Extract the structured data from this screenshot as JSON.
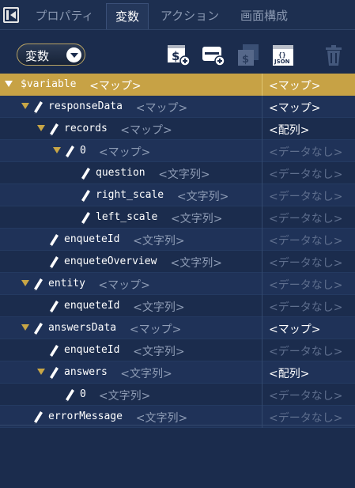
{
  "tabs": [
    {
      "label": "プロパティ",
      "active": false
    },
    {
      "label": "変数",
      "active": true
    },
    {
      "label": "アクション",
      "active": false
    },
    {
      "label": "画面構成",
      "active": false
    }
  ],
  "scope_select": {
    "value": "変数"
  },
  "toolbar_icons": {
    "add_variable": "dollar-add-icon",
    "add_storage": "storage-add-icon",
    "convert": "dollar-stack-icon",
    "json": "JSON",
    "delete": "trash-icon"
  },
  "tree": [
    {
      "name": "$variable",
      "type": "<マップ>",
      "value": "<マップ>",
      "expanded": true,
      "level": 0
    },
    {
      "name": "responseData",
      "type": "<マップ>",
      "value": "<マップ>",
      "expanded": true,
      "level": 1
    },
    {
      "name": "records",
      "type": "<マップ>",
      "value": "<配列>",
      "expanded": true,
      "level": 2
    },
    {
      "name": "0",
      "type": "<マップ>",
      "value": "<データなし>",
      "expanded": true,
      "level": 3
    },
    {
      "name": "question",
      "type": "<文字列>",
      "value": "<データなし>",
      "level": 4
    },
    {
      "name": "right_scale",
      "type": "<文字列>",
      "value": "<データなし>",
      "level": 4
    },
    {
      "name": "left_scale",
      "type": "<文字列>",
      "value": "<データなし>",
      "level": 4
    },
    {
      "name": "enqueteId",
      "type": "<文字列>",
      "value": "<データなし>",
      "level": 2
    },
    {
      "name": "enqueteOverview",
      "type": "<文字列>",
      "value": "<データなし>",
      "level": 2
    },
    {
      "name": "entity",
      "type": "<マップ>",
      "value": "<データなし>",
      "expanded": true,
      "level": 1
    },
    {
      "name": "enqueteId",
      "type": "<文字列>",
      "value": "<データなし>",
      "level": 2
    },
    {
      "name": "answersData",
      "type": "<マップ>",
      "value": "<マップ>",
      "expanded": true,
      "level": 1
    },
    {
      "name": "enqueteId",
      "type": "<文字列>",
      "value": "<データなし>",
      "level": 2
    },
    {
      "name": "answers",
      "type": "<文字列>",
      "value": "<配列>",
      "expanded": true,
      "level": 2
    },
    {
      "name": "0",
      "type": "<文字列>",
      "value": "<データなし>",
      "level": 3
    },
    {
      "name": "errorMessage",
      "type": "<文字列>",
      "value": "<データなし>",
      "level": 1
    }
  ],
  "colors": {
    "selected_row": "#c7a245",
    "background": "#1b2c4d",
    "accent": "#c8a646"
  }
}
